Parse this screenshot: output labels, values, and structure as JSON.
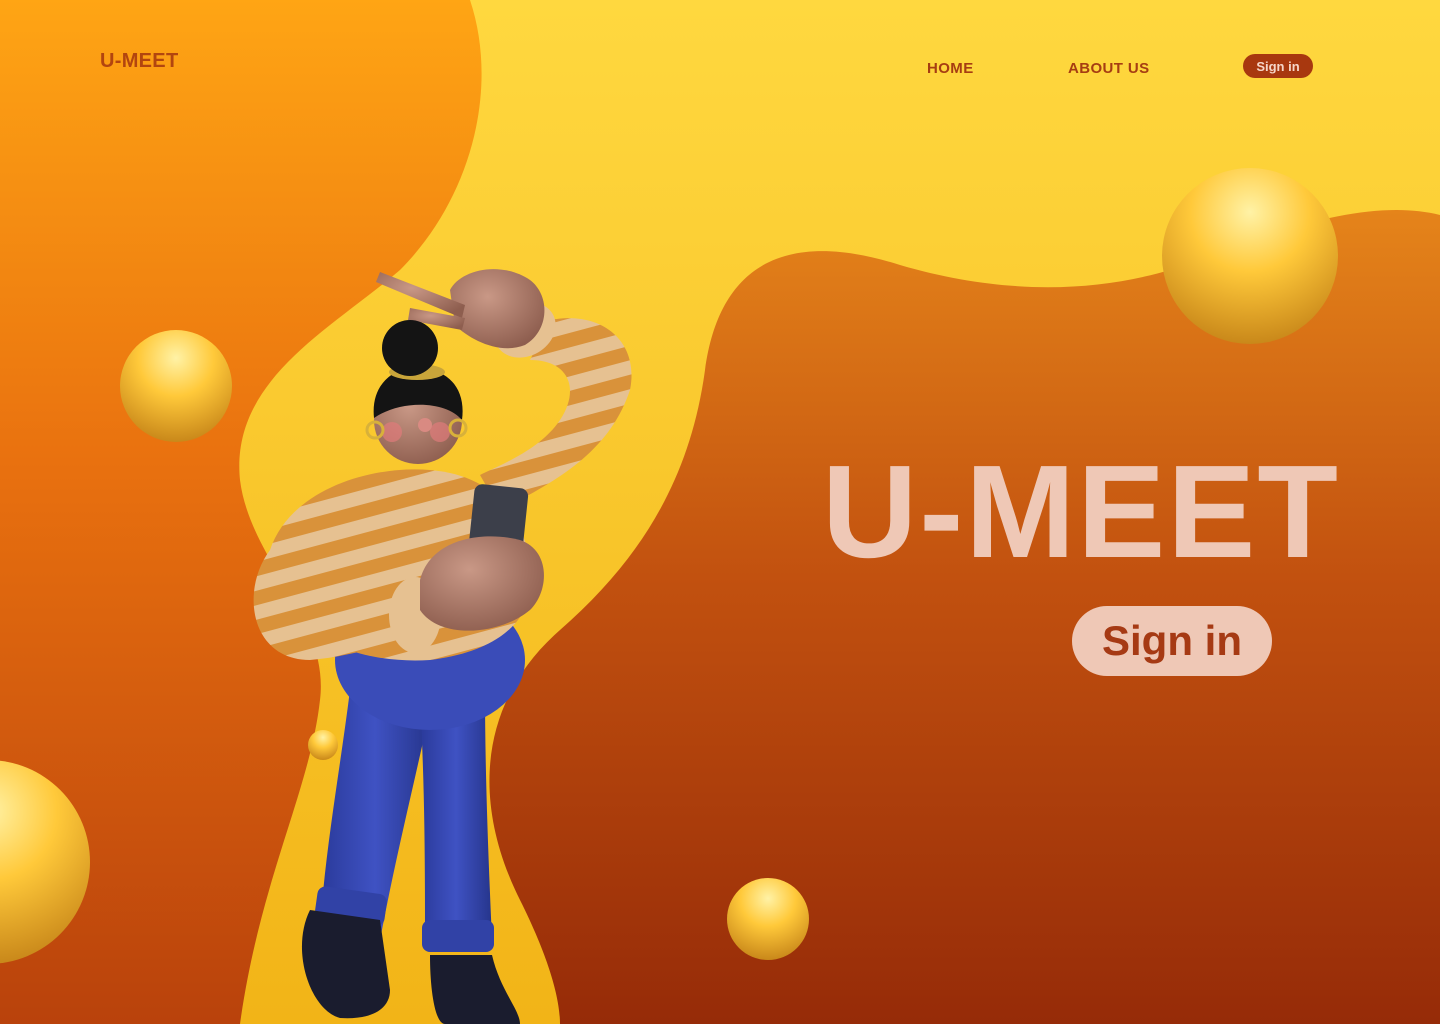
{
  "nav": {
    "logo": "U-MEET",
    "links": [
      {
        "label": "HOME"
      },
      {
        "label": "ABOUT US"
      }
    ],
    "signin_label": "Sign in"
  },
  "hero": {
    "title": "U-MEET",
    "signin_label": "Sign in"
  },
  "colors": {
    "accent_dark": "#a8380f",
    "hero_text": "#efc8b6",
    "background_yellow": "#ffd33f",
    "background_orange": "#e07a12"
  }
}
